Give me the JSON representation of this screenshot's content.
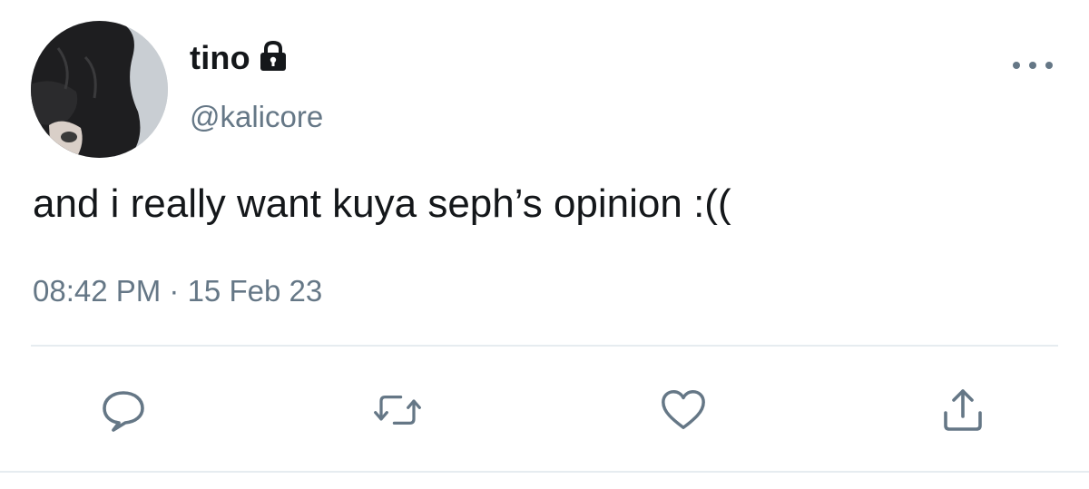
{
  "tweet": {
    "display_name": "tino",
    "protected_icon": "lock-icon",
    "handle": "@kalicore",
    "text": "and i really want kuya seph’s opinion :((",
    "timestamp": "08:42 PM · 15 Feb 23"
  },
  "menu": {
    "icon": "more-dots-icon"
  },
  "actions": {
    "reply_icon": "reply-bubble-icon",
    "retweet_icon": "retweet-icon",
    "like_icon": "heart-icon",
    "share_icon": "share-upload-icon"
  },
  "colors": {
    "text_primary": "#14171a",
    "text_secondary": "#657786",
    "divider": "#e6ecf0"
  }
}
